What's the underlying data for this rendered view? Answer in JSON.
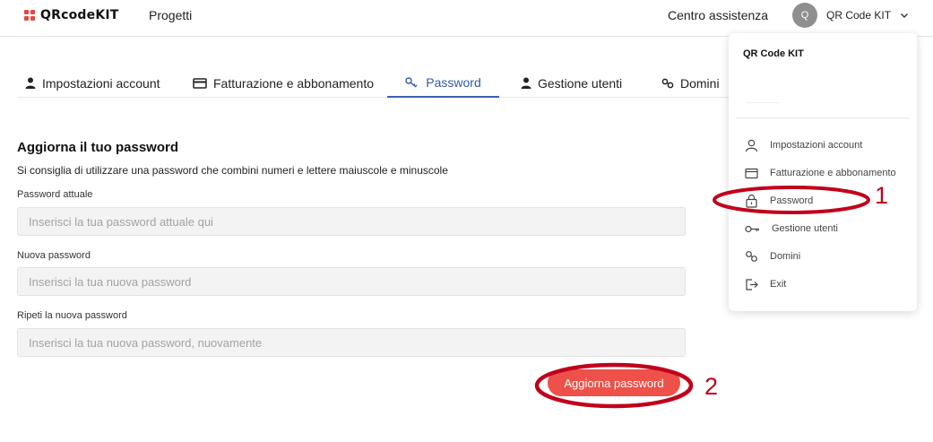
{
  "header": {
    "logo_text": "QRcodeKIT",
    "projects_label": "Progetti",
    "help_label": "Centro assistenza",
    "avatar_initial": "Q",
    "user_name": "QR Code KIT"
  },
  "tabs": [
    {
      "label": "Impostazioni account",
      "icon": "user-icon"
    },
    {
      "label": "Fatturazione e abbonamento",
      "icon": "credit-card-icon"
    },
    {
      "label": "Password",
      "icon": "key-icon",
      "active": true
    },
    {
      "label": "Gestione utenti",
      "icon": "user-icon"
    },
    {
      "label": "Domini",
      "icon": "link-icon"
    }
  ],
  "form": {
    "title": "Aggiorna il tuo password",
    "hint": "Si consiglia di utilizzare una password che combini numeri e lettere maiuscole e minuscole",
    "current_label": "Password attuale",
    "current_placeholder": "Inserisci la tua password attuale qui",
    "new_label": "Nuova password",
    "new_placeholder": "Inserisci la tua nuova password",
    "repeat_label": "Ripeti la nuova password",
    "repeat_placeholder": "Inserisci la tua nuova password, nuovamente",
    "submit_label": "Aggiorna password"
  },
  "dropdown": {
    "title": "QR Code KIT",
    "items": [
      {
        "label": "Impostazioni account",
        "icon": "user-icon"
      },
      {
        "label": "Fatturazione e abbonamento",
        "icon": "credit-card-icon"
      },
      {
        "label": "Password",
        "icon": "lock-icon"
      },
      {
        "label": "Gestione utenti",
        "icon": "key-icon"
      },
      {
        "label": "Domini",
        "icon": "link-icon"
      },
      {
        "label": "Exit",
        "icon": "logout-icon"
      }
    ]
  },
  "annotations": {
    "marker_1": "1",
    "marker_2": "2",
    "color": "#c0001a"
  },
  "colors": {
    "accent": "#3b62b0",
    "button": "#ee5149",
    "logo": "#e8473f"
  }
}
